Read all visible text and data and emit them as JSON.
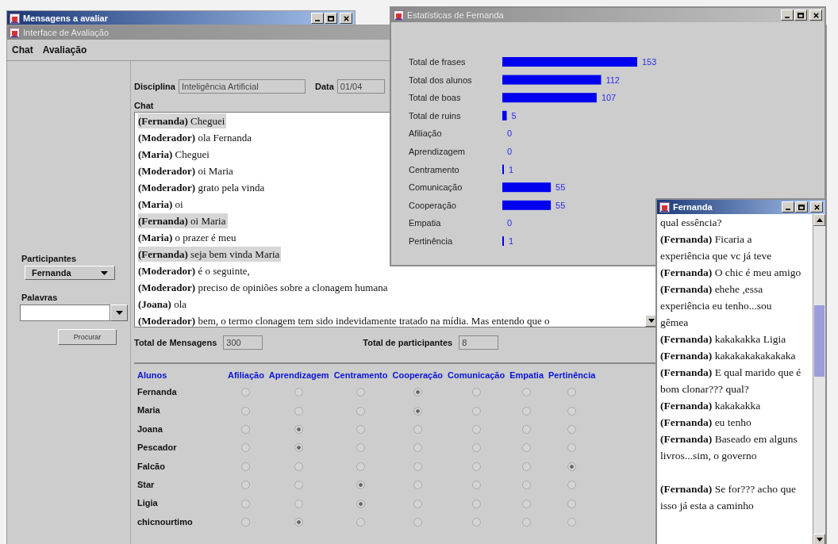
{
  "back_window": {
    "title": "Mensagens a avaliar"
  },
  "main_window": {
    "title": "Interface de Avaliação",
    "menu": [
      "Chat",
      "Avaliação"
    ],
    "sidebar": {
      "participants_label": "Participantes",
      "participant": "Fernanda",
      "words_label": "Palavras",
      "search_button": "Procurar"
    },
    "discipline": {
      "label": "Disciplina",
      "value": "Inteligência Artificial"
    },
    "date": {
      "label": "Data",
      "value": "01/04"
    },
    "chat_label": "Chat",
    "chat": [
      {
        "text": "**(Fernanda)** Cheguei",
        "highlighted": true
      },
      {
        "text": "**(Moderador)** ola Fernanda",
        "highlighted": false
      },
      {
        "text": "**(Maria)** Cheguei",
        "highlighted": false
      },
      {
        "text": "**(Moderador)** oi Maria",
        "highlighted": false
      },
      {
        "text": "**(Moderador)** grato pela vinda",
        "highlighted": false
      },
      {
        "text": "**(Maria)** oi",
        "highlighted": false
      },
      {
        "text": "**(Fernanda)** oi Maria",
        "highlighted": true
      },
      {
        "text": "**(Maria)** o prazer é meu",
        "highlighted": false
      },
      {
        "text": "**(Fernanda)** seja bem vinda Maria",
        "highlighted": true
      },
      {
        "text": "**(Moderador)** é o seguinte,",
        "highlighted": false
      },
      {
        "text": "**(Moderador)** preciso de opiniões sobre a clonagem humana",
        "highlighted": false
      },
      {
        "text": "**(Joana)** ola",
        "highlighted": false
      },
      {
        "text": "**(Moderador)** bem, o termo clonagem tem sido indevidamente tratado na mídia. Mas entendo que o",
        "highlighted": false
      }
    ],
    "totals": [
      {
        "label": "Total de Mensagens",
        "value": "300"
      },
      {
        "label": "Total de participantes",
        "value": "8"
      }
    ],
    "grid": {
      "columns": [
        "Alunos",
        "Afiliação",
        "Aprendizagem",
        "Centramento",
        "Cooperação",
        "Comunicação",
        "Empatia",
        "Pertinência"
      ],
      "rows": [
        {
          "name": "Fernanda",
          "options": [
            {
              "selected": false
            },
            {
              "selected": false
            },
            {
              "selected": false
            },
            {
              "selected": true
            },
            {
              "selected": false
            },
            {
              "selected": false
            },
            {
              "selected": false
            }
          ]
        },
        {
          "name": "Maria",
          "options": [
            {
              "selected": false
            },
            {
              "selected": false
            },
            {
              "selected": false
            },
            {
              "selected": true
            },
            {
              "selected": false
            },
            {
              "selected": false
            },
            {
              "selected": false
            }
          ]
        },
        {
          "name": "Joana",
          "options": [
            {
              "selected": false
            },
            {
              "selected": true
            },
            {
              "selected": false
            },
            {
              "selected": false
            },
            {
              "selected": false
            },
            {
              "selected": false
            },
            {
              "selected": false
            }
          ]
        },
        {
          "name": "Pescador",
          "options": [
            {
              "selected": false
            },
            {
              "selected": true
            },
            {
              "selected": false
            },
            {
              "selected": false
            },
            {
              "selected": false
            },
            {
              "selected": false
            },
            {
              "selected": false
            }
          ]
        },
        {
          "name": "Falcão",
          "options": [
            {
              "selected": false
            },
            {
              "selected": false
            },
            {
              "selected": false
            },
            {
              "selected": false
            },
            {
              "selected": false
            },
            {
              "selected": false
            },
            {
              "selected": true
            }
          ]
        },
        {
          "name": "Star",
          "options": [
            {
              "selected": false
            },
            {
              "selected": false
            },
            {
              "selected": true
            },
            {
              "selected": false
            },
            {
              "selected": false
            },
            {
              "selected": false
            },
            {
              "selected": false
            }
          ]
        },
        {
          "name": "Ligia",
          "options": [
            {
              "selected": false
            },
            {
              "selected": false
            },
            {
              "selected": true
            },
            {
              "selected": false
            },
            {
              "selected": false
            },
            {
              "selected": false
            },
            {
              "selected": false
            }
          ]
        },
        {
          "name": "chicnourtimo",
          "options": [
            {
              "selected": false
            },
            {
              "selected": true
            },
            {
              "selected": false
            },
            {
              "selected": false
            },
            {
              "selected": false
            },
            {
              "selected": false
            },
            {
              "selected": false
            }
          ]
        }
      ]
    }
  },
  "stats_window": {
    "title": "Estatísticas de Fernanda",
    "chart_data": {
      "type": "bar",
      "orientation": "horizontal",
      "data_labels": true,
      "categories": [
        "Total de frases",
        "Total dos alunos",
        "Total de boas",
        "Total de ruins",
        "Afiliação",
        "Aprendizagem",
        "Centramento",
        "Comunicação",
        "Cooperação",
        "Empatia",
        "Pertinência"
      ],
      "values": [
        153,
        112,
        107,
        5,
        0,
        0,
        1,
        55,
        55,
        0,
        1
      ]
    }
  },
  "fernanda_window": {
    "title": "Fernanda",
    "messages": [
      {
        "text": "qual essência?",
        "blank_line_before": false
      },
      {
        "text": "**(Fernanda)** Ficaria a experiência que vc já teve",
        "blank_line_before": false
      },
      {
        "text": "**(Fernanda)** O chic é meu amigo",
        "blank_line_before": false
      },
      {
        "text": "**(Fernanda)** ehehe ,essa experiência eu tenho...sou gêmea",
        "blank_line_before": false
      },
      {
        "text": "**(Fernanda)** kakakakka Ligia",
        "blank_line_before": false
      },
      {
        "text": "**(Fernanda)** kakakakakakakaka",
        "blank_line_before": false
      },
      {
        "text": "**(Fernanda)** E qual marido que é bom clonar??? qual?",
        "blank_line_before": false
      },
      {
        "text": "**(Fernanda)** kakakakka",
        "blank_line_before": false
      },
      {
        "text": "**(Fernanda)** eu tenho",
        "blank_line_before": false
      },
      {
        "text": "**(Fernanda)** Baseado em alguns livros...sim, o governo",
        "blank_line_before": false
      },
      {
        "text": "**(Fernanda)** Se for??? acho que isso já esta a caminho",
        "blank_line_before": true
      }
    ]
  }
}
